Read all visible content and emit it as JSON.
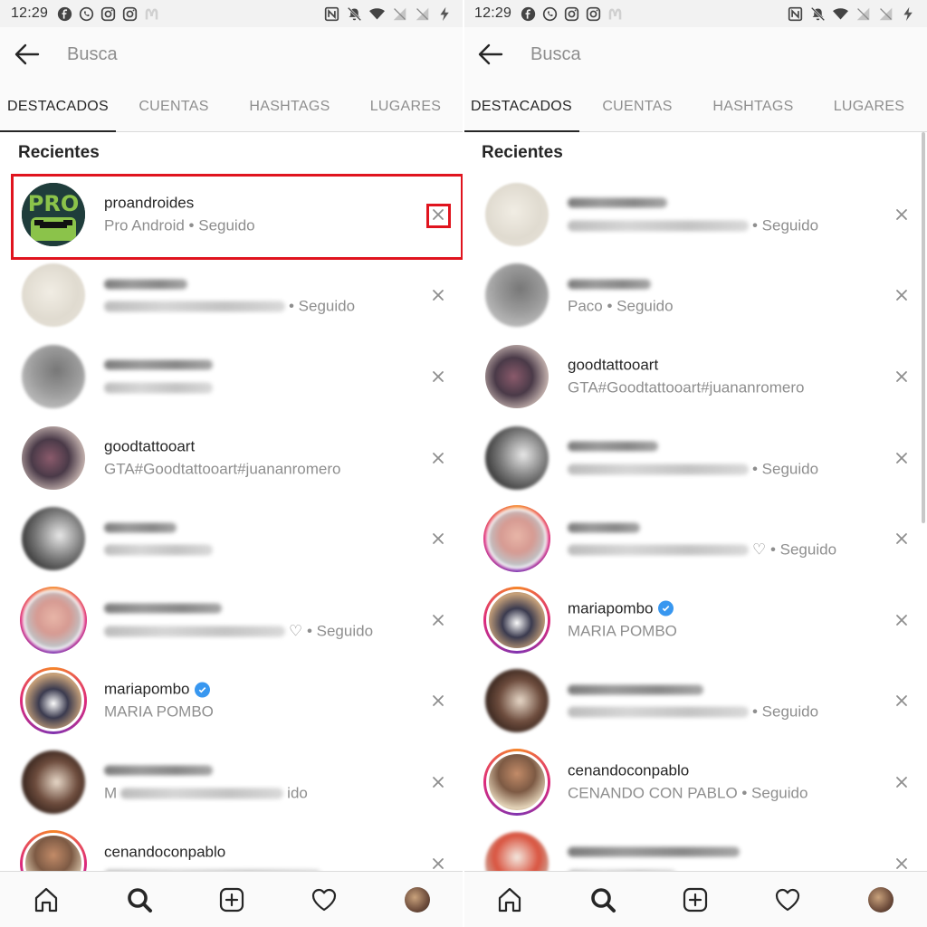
{
  "status": {
    "time": "12:29"
  },
  "search": {
    "placeholder": "Busca"
  },
  "tabs": [
    "DESTACADOS",
    "CUENTAS",
    "HASHTAGS",
    "LUGARES"
  ],
  "section_title": "Recientes",
  "left_list": [
    {
      "username": "proandroides",
      "subtitle": "Pro Android • Seguido",
      "avatar": "pro-android-logo",
      "highlighted": true
    },
    {
      "username": "",
      "subtitle": "• Seguido",
      "avatar": "blurred-light",
      "blurred": true
    },
    {
      "username": "",
      "subtitle": "",
      "avatar": "blurred-gray",
      "blurred": true
    },
    {
      "username": "goodtattooart",
      "subtitle": "GTA#Goodtattooart#juananromero",
      "avatar": "tattoo"
    },
    {
      "username": "",
      "subtitle": "",
      "avatar": "blurred-dark",
      "blurred": true
    },
    {
      "username": "",
      "subtitle": "♡ • Seguido",
      "avatar": "blurred-story",
      "blurred": true,
      "story": true
    },
    {
      "username": "mariapombo",
      "subtitle": "MARIA POMBO",
      "avatar": "wedding",
      "verified": true,
      "story": true
    },
    {
      "username": "",
      "subtitle": "M",
      "subtitle_tail": "ido",
      "avatar": "blurred-brown",
      "blurred": true
    },
    {
      "username": "cenandoconpablo",
      "subtitle": "",
      "avatar": "pablo",
      "story": true
    }
  ],
  "right_list": [
    {
      "username": "",
      "subtitle": "• Seguido",
      "avatar": "blurred-light",
      "blurred": true
    },
    {
      "username": "",
      "subtitle": "Paco • Seguido",
      "avatar": "blurred-gray",
      "blurred": true,
      "subtitle_plain": true
    },
    {
      "username": "goodtattooart",
      "subtitle": "GTA#Goodtattooart#juananromero",
      "avatar": "tattoo"
    },
    {
      "username": "",
      "subtitle": "• Seguido",
      "avatar": "blurred-dark",
      "blurred": true
    },
    {
      "username": "",
      "subtitle": "♡ • Seguido",
      "avatar": "blurred-story",
      "blurred": true,
      "story": true
    },
    {
      "username": "mariapombo",
      "subtitle": "MARIA POMBO",
      "avatar": "wedding",
      "verified": true,
      "story": true
    },
    {
      "username": "",
      "subtitle": "• Seguido",
      "avatar": "blurred-brown",
      "blurred": true
    },
    {
      "username": "cenandoconpablo",
      "subtitle": "CENANDO CON PABLO • Seguido",
      "avatar": "pablo",
      "story": true
    },
    {
      "username": "",
      "subtitle": "",
      "avatar": "blurred-food",
      "blurred": true
    }
  ],
  "icons": {
    "back": "arrow-left-icon",
    "remove": "close-icon",
    "nav": [
      "home-icon",
      "search-icon",
      "add-post-icon",
      "heart-icon",
      "profile-avatar"
    ]
  },
  "colors": {
    "highlight": "#e0141e",
    "verified": "#3897f0",
    "muted": "#8e8e8e",
    "text": "#262626"
  }
}
